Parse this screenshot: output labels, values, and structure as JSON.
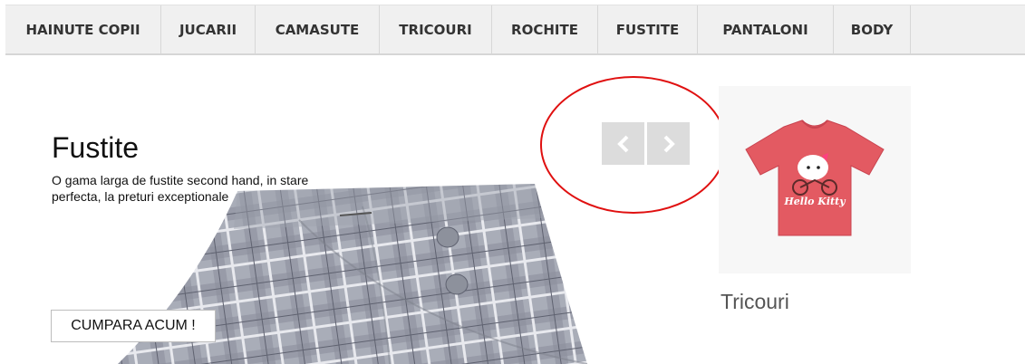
{
  "nav": {
    "items": [
      {
        "label": "HAINUTE COPII"
      },
      {
        "label": "JUCARII"
      },
      {
        "label": "CAMASUTE"
      },
      {
        "label": "TRICOURI"
      },
      {
        "label": "ROCHITE"
      },
      {
        "label": "FUSTITE"
      },
      {
        "label": "PANTALONI"
      },
      {
        "label": "BODY"
      }
    ]
  },
  "slider": {
    "title": "Fustite",
    "description": "O gama larga de fustite second hand, in stare perfecta, la preturi exceptionale",
    "cta_label": "CUMPARA ACUM !",
    "prev_icon": "chevron-left-icon",
    "next_icon": "chevron-right-icon"
  },
  "annotation": {
    "color": "#e01010"
  },
  "side_product": {
    "title": "Tricouri",
    "print_text": "Hello Kitty",
    "shirt_color": "#e35a62"
  }
}
